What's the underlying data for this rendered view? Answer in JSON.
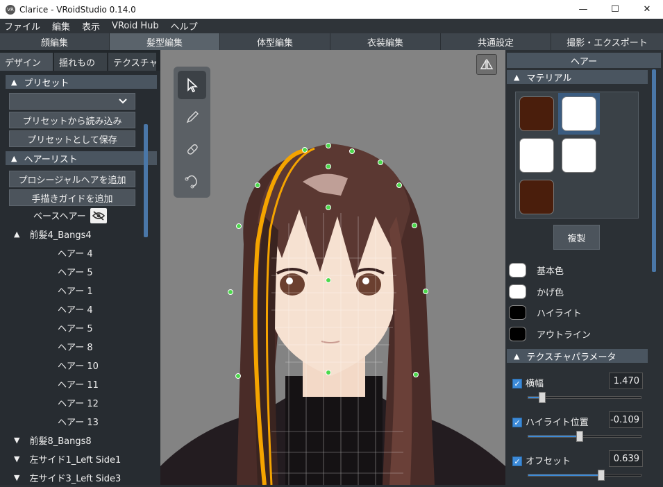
{
  "window": {
    "title": "Clarice - VRoidStudio 0.14.0",
    "app_icon_text": "VR",
    "minimize": "—",
    "maximize": "☐",
    "close": "✕"
  },
  "menu": [
    "ファイル",
    "編集",
    "表示",
    "VRoid Hub",
    "ヘルプ"
  ],
  "main_tabs": [
    {
      "label": "顔編集"
    },
    {
      "label": "髪型編集",
      "active": true
    },
    {
      "label": "体型編集"
    },
    {
      "label": "衣装編集"
    },
    {
      "label": "共通設定"
    },
    {
      "label": "撮影・エクスポート"
    }
  ],
  "left": {
    "subtabs": [
      "デザイン",
      "揺れもの",
      "テクスチャ"
    ],
    "preset": {
      "header": "プリセット",
      "select_value": "",
      "load_label": "プリセットから読み込み",
      "save_label": "プリセットとして保存"
    },
    "hairlist": {
      "header": "ヘアーリスト",
      "add_procedural": "プロシージャルヘアを追加",
      "add_guide": "手描きガイドを追加",
      "base_hair": "ベースヘアー",
      "groups": [
        {
          "label": "前髪4_Bangs4",
          "expanded": true,
          "items": [
            "ヘアー 4",
            "ヘアー 5",
            "ヘアー 1",
            "ヘアー 4",
            "ヘアー 5",
            "ヘアー 8",
            "ヘアー 10",
            "ヘアー 11",
            "ヘアー 12",
            "ヘアー 13"
          ]
        },
        {
          "label": "前髪8_Bangs8",
          "expanded": false
        },
        {
          "label": "左サイド1_Left Side1",
          "expanded": false
        },
        {
          "label": "左サイド3_Left Side3",
          "expanded": false
        }
      ]
    }
  },
  "right": {
    "title": "ヘアー",
    "material": {
      "header": "マテリアル",
      "swatches": [
        "#4a1e0c",
        "#ffffff",
        "#ffffff",
        "#ffffff",
        "#4a1e0c"
      ],
      "selected_index": 1,
      "duplicate_label": "複製"
    },
    "colors": [
      {
        "label": "基本色",
        "color": "#ffffff"
      },
      {
        "label": "かげ色",
        "color": "#ffffff"
      },
      {
        "label": "ハイライト",
        "color": "#000000"
      },
      {
        "label": "アウトライン",
        "color": "#000000"
      }
    ],
    "texture_params": {
      "header": "テクスチャパラメータ",
      "params": [
        {
          "label": "横幅",
          "value": "1.470",
          "checked": true,
          "level": 0.12
        },
        {
          "label": "ハイライト位置",
          "value": "-0.109",
          "checked": true,
          "level": 0.45
        },
        {
          "label": "オフセット",
          "value": "0.639",
          "checked": true,
          "level": 0.64
        }
      ]
    }
  }
}
